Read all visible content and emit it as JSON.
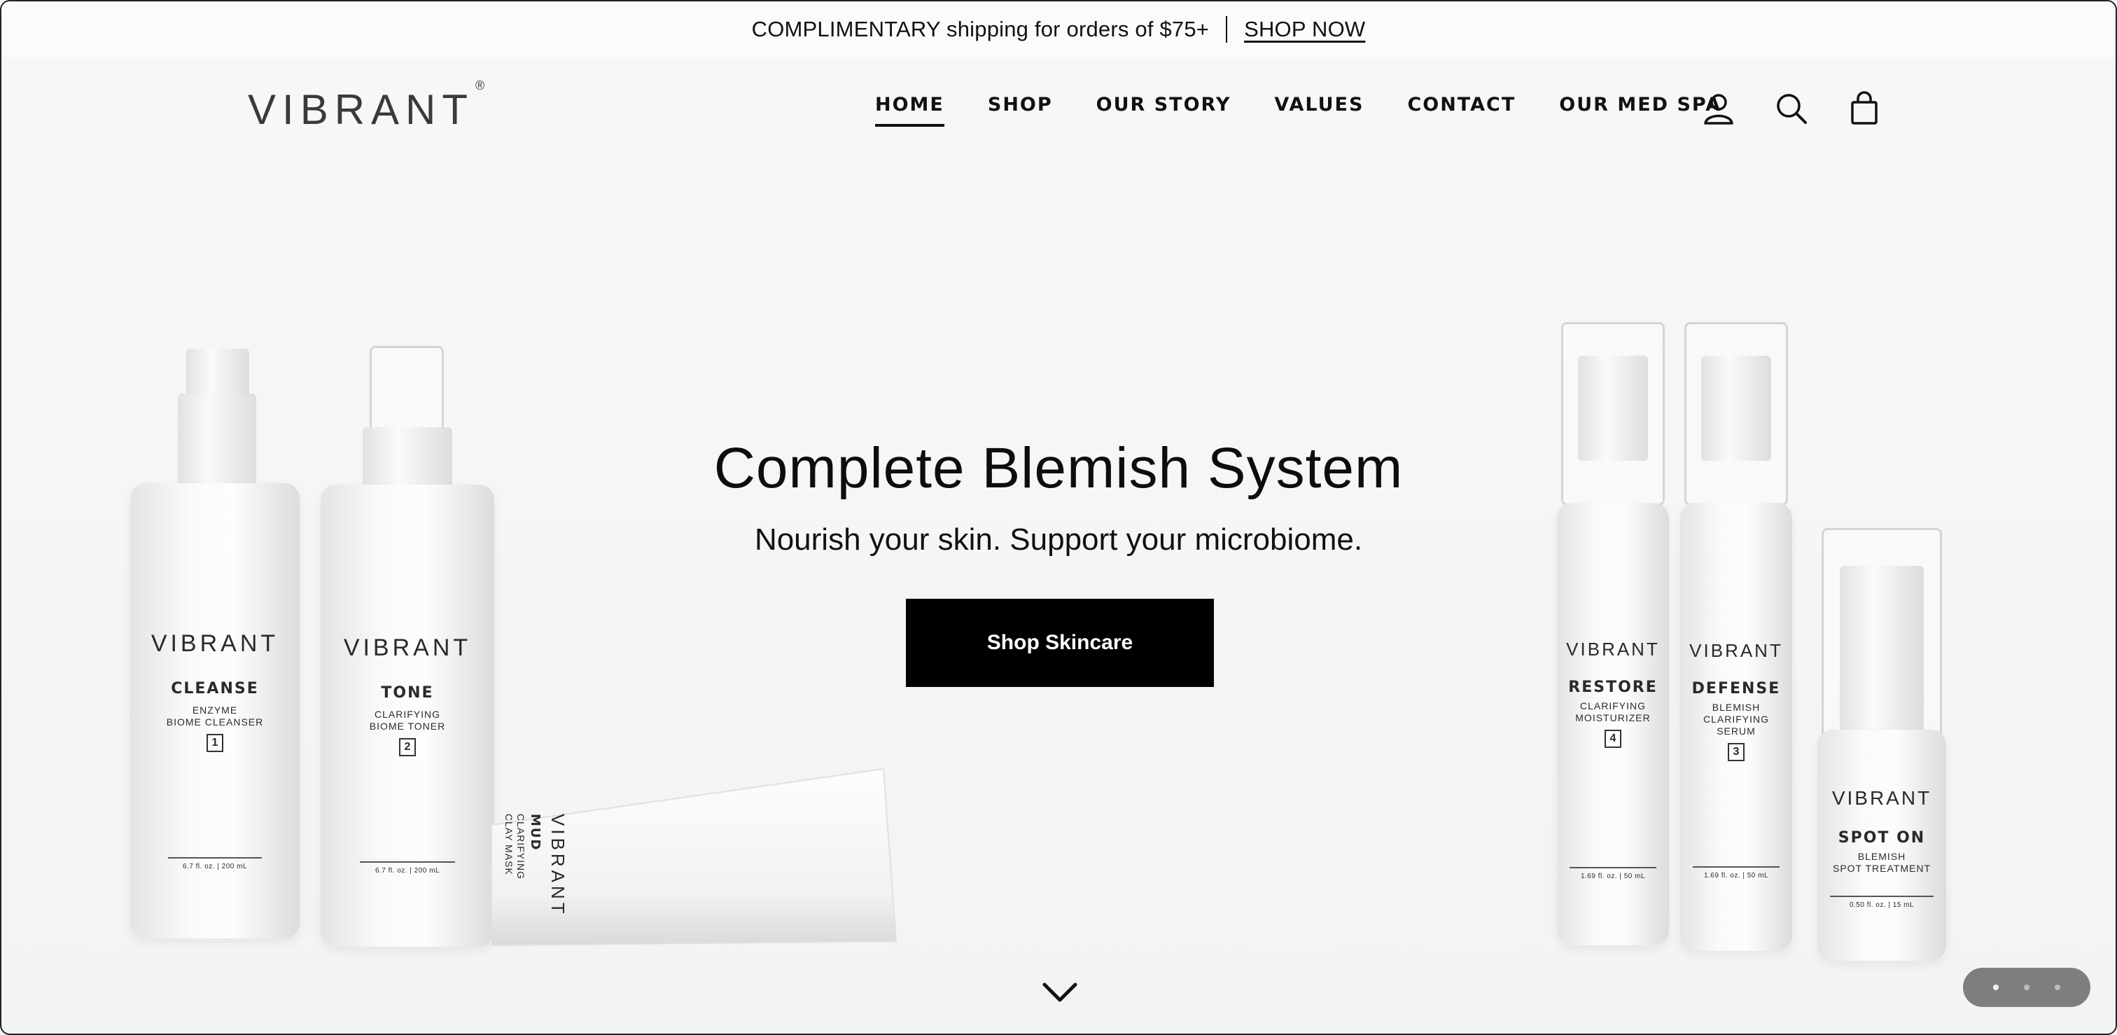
{
  "announcement": {
    "text": "COMPLIMENTARY shipping for orders of $75+",
    "link": "SHOP NOW"
  },
  "header": {
    "logo": "VIBRANT",
    "logo_mark": "®",
    "nav": [
      "HOME",
      "SHOP",
      "OUR STORY",
      "VALUES",
      "CONTACT",
      "OUR MED SPA"
    ],
    "active_nav": "HOME",
    "icons": [
      "account-icon",
      "search-icon",
      "cart-icon"
    ]
  },
  "hero": {
    "title": "Complete Blemish System",
    "subtitle": "Nourish your skin. Support your microbiome.",
    "cta": "Shop Skincare"
  },
  "products": {
    "cleanse": {
      "brand": "VIBRANT",
      "name": "CLEANSE",
      "desc1": "ENZYME",
      "desc2": "BIOME CLEANSER",
      "num": "1",
      "vol": "6.7 fl. oz. | 200 mL"
    },
    "tone": {
      "brand": "VIBRANT",
      "name": "TONE",
      "desc1": "CLARIFYING",
      "desc2": "BIOME TONER",
      "num": "2",
      "vol": "6.7 fl. oz. | 200 mL"
    },
    "mud": {
      "brand": "VIBRANT",
      "name": "MUD",
      "desc1": "CLARIFYING",
      "desc2": "CLAY MASK"
    },
    "restore": {
      "brand": "VIBRANT",
      "name": "RESTORE",
      "desc1": "CLARIFYING",
      "desc2": "MOISTURIZER",
      "num": "4",
      "vol": "1.69 fl. oz. | 50 mL"
    },
    "defense": {
      "brand": "VIBRANT",
      "name": "DEFENSE",
      "desc1": "BLEMISH",
      "desc2": "CLARIFYING",
      "desc3": "SERUM",
      "num": "3",
      "vol": "1.69 fl. oz. | 50 mL"
    },
    "spot": {
      "brand": "VIBRANT",
      "name": "SPOT ON",
      "desc1": "BLEMISH",
      "desc2": "SPOT TREATMENT",
      "vol": "0.50 fl. oz. | 15 mL"
    }
  },
  "slideshow": {
    "slides": 3,
    "active": 1
  }
}
